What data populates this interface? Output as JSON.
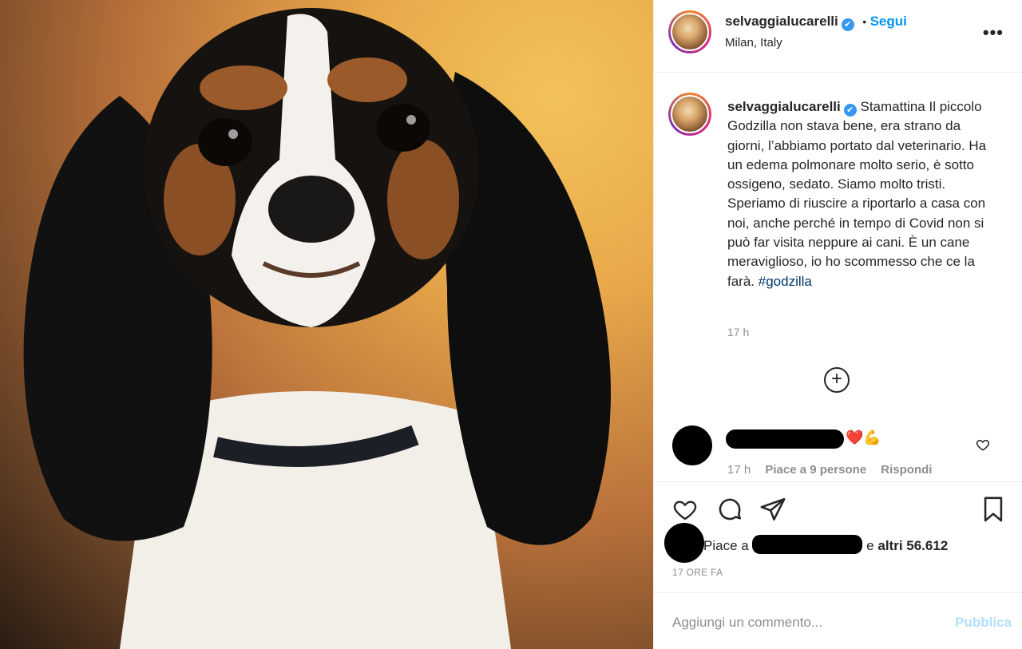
{
  "post": {
    "username": "selvaggialucarelli",
    "verified_mark": "✔",
    "follow_separator": "•",
    "follow_label": "Segui",
    "location": "Milan, Italy",
    "more_label": "•••"
  },
  "caption": {
    "username": "selvaggialucarelli",
    "text": "Stamattina Il piccolo Godzilla non stava bene, era strano da giorni, l’abbiamo portato dal veterinario. Ha un edema polmonare molto serio, è sotto ossigeno, sedato. Siamo molto tristi. Speriamo di riuscire a riportarlo a casa con noi, anche perché in tempo di Covid non si può far visita neppure ai cani. È un cane meraviglioso, io ho scommesso che ce la farà.",
    "hashtag": "#godzilla",
    "time": "17 h"
  },
  "load_more": "+",
  "comment": {
    "emojis": "❤️💪",
    "time": "17 h",
    "likes": "Piace a 9 persone",
    "reply": "Rispondi"
  },
  "likes": {
    "prefix": "Piace a",
    "suffix": "e",
    "others": "altri 56.612"
  },
  "posted_ago": "17 ORE FA",
  "add_comment": {
    "placeholder": "Aggiungi un commento...",
    "publish": "Pubblica"
  },
  "icons": {
    "like": "heart-icon",
    "comment": "comment-icon",
    "share": "paper-plane-icon",
    "save": "bookmark-icon",
    "comment_like": "small-heart-icon"
  },
  "colors": {
    "link": "#0095f6",
    "hashtag": "#00376b",
    "muted": "#8e8e8e",
    "publish_disabled": "#b2dffc"
  }
}
